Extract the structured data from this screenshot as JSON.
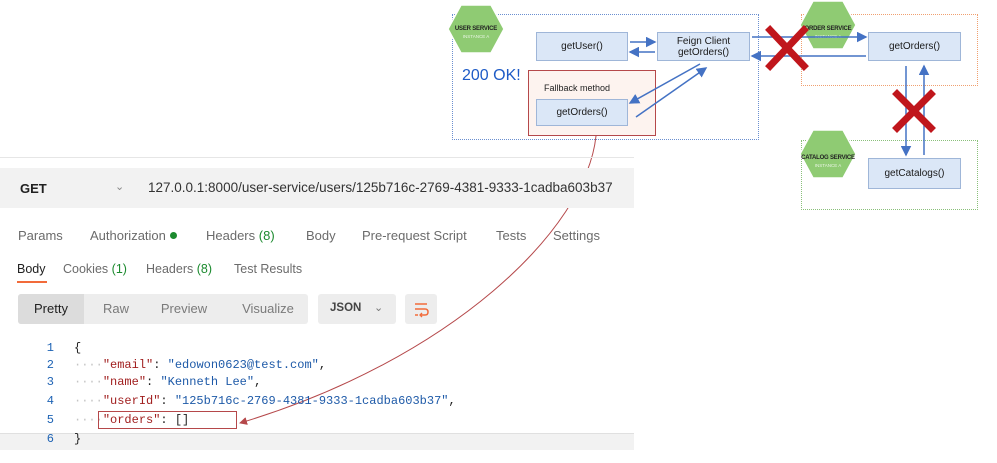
{
  "diagram": {
    "user_service": {
      "name": "USER SERVICE",
      "instance": "INSTANCE A"
    },
    "order_service": {
      "name": "ORDER SERVICE",
      "instance": "INSTANCE A"
    },
    "catalog_service": {
      "name": "CATALOG SERVICE",
      "instance": "INSTANCE A"
    },
    "get_user": "getUser()",
    "feign_client": {
      "line1": "Feign Client",
      "line2": "getOrders()"
    },
    "fallback_title": "Fallback method",
    "fallback_get_orders": "getOrders()",
    "order_get_orders": "getOrders()",
    "get_catalogs": "getCatalogs()",
    "status": "200 OK!",
    "colors": {
      "hex_green": "#8fcb73",
      "cross_red": "#c0161c",
      "arrow_blue": "#4472c4",
      "curve_red": "#b5484a"
    }
  },
  "request": {
    "method": "GET",
    "url": "127.0.0.1:8000/user-service/users/125b716c-2769-4381-9333-1cadba603b37"
  },
  "request_tabs": {
    "params": "Params",
    "authorization": "Authorization",
    "headers": "Headers",
    "headers_count": "(8)",
    "body": "Body",
    "prerequest": "Pre-request Script",
    "tests": "Tests",
    "settings": "Settings"
  },
  "response_tabs": {
    "body": "Body",
    "cookies": "Cookies",
    "cookies_count": "(1)",
    "headers": "Headers",
    "headers_count": "(8)",
    "test_results": "Test Results"
  },
  "view": {
    "pretty": "Pretty",
    "raw": "Raw",
    "preview": "Preview",
    "visualize": "Visualize",
    "format": "JSON"
  },
  "response_body": {
    "line_numbers": [
      "1",
      "2",
      "3",
      "4",
      "5",
      "6"
    ],
    "open_brace": "{",
    "close_brace": "}",
    "email_key": "\"email\"",
    "email_value": "\"edowon0623@test.com\"",
    "name_key": "\"name\"",
    "name_value": "\"Kenneth Lee\"",
    "userid_key": "\"userId\"",
    "userid_value": "\"125b716c-2769-4381-9333-1cadba603b37\"",
    "orders_key": "\"orders\"",
    "orders_value": "[]"
  }
}
